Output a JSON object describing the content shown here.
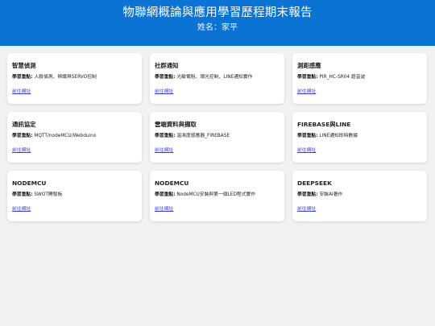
{
  "header": {
    "title": "物聯網概論與應用學習歷程期末報告",
    "subtitle": "姓名：家平"
  },
  "focus_label": "學習重點:",
  "cards": [
    {
      "title": "智慧偵測",
      "focus": "人臉偵測、辨識與SERVO控制",
      "link": "前往網址"
    },
    {
      "title": "社群通知",
      "focus": "光敏電阻、環光控制、LINE通知實作",
      "link": "前往網址"
    },
    {
      "title": "測距感應",
      "focus": "PIR_HC-SR04 超音波",
      "link": "前往網址"
    },
    {
      "title": "通訊協定",
      "focus": "MQTT/nodeMCU/Webduino",
      "link": "前往網址"
    },
    {
      "title": "雲端資料與擷取",
      "focus": "溫濕度感應器_FIREBASE",
      "link": "前往網址"
    },
    {
      "title": "FIREBASE與LINE",
      "focus": "LINE通知即時數據",
      "link": "前往網址"
    },
    {
      "title": "NODEMCU",
      "focus": "SWOT開發板",
      "link": "前往網址"
    },
    {
      "title": "NODEMCU",
      "focus": "NodeMCU安裝與第一個LED程式實作",
      "link": "前往網址"
    },
    {
      "title": "DEEPSEEK",
      "focus": "安裝AI著作",
      "link": "前往網址"
    }
  ]
}
